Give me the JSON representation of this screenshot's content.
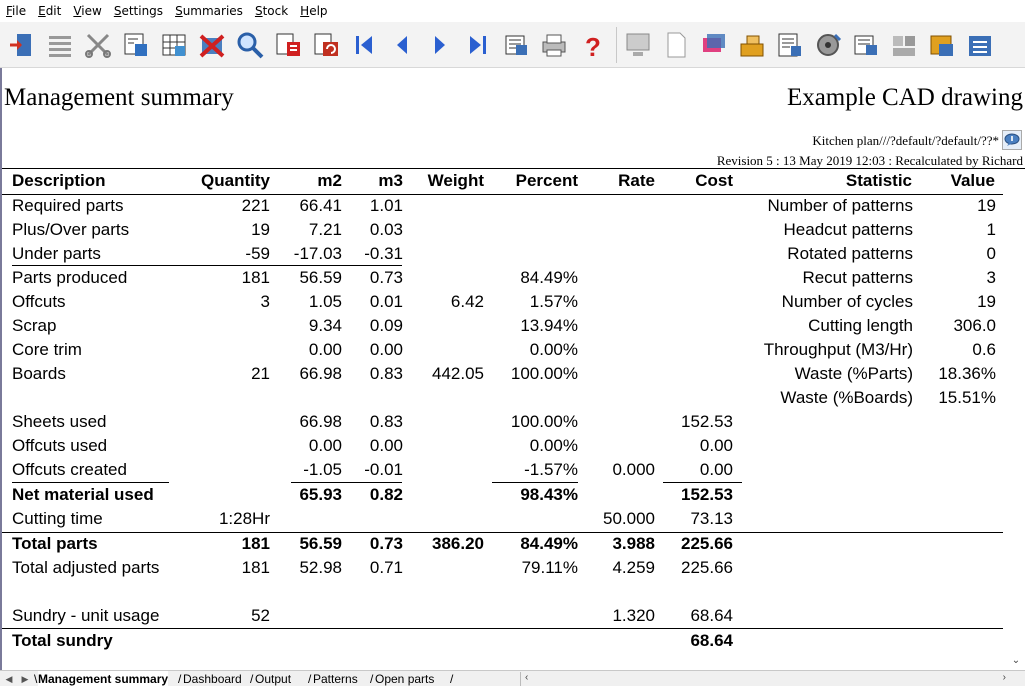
{
  "menu": [
    "File",
    "Edit",
    "View",
    "Settings",
    "Summaries",
    "Stock",
    "Help"
  ],
  "toolbar_icons": [
    "exit-icon",
    "list-icon",
    "scissors-icon",
    "print-preview-icon",
    "grid-icon",
    "cancel-icon",
    "magnifier-icon",
    "report-icon",
    "recalculate-icon",
    "first-page-icon",
    "previous-page-icon",
    "next-page-icon",
    "last-page-icon",
    "export-icon",
    "printer-icon",
    "help-icon",
    "layout-icon",
    "blank-page-icon",
    "labels-icon",
    "stock-icon",
    "edit-icon",
    "saw-icon",
    "batch-icon",
    "pattern-icon",
    "parts-icon",
    "options-icon"
  ],
  "report": {
    "title": "Management summary",
    "drawing": "Example CAD drawing",
    "plan_line": "Kitchen plan///?default/?default/??*",
    "revision_line": "Revision 5 : 13 May 2019 12:03 : Recalculated by Richard"
  },
  "table": {
    "headers": {
      "description": "Description",
      "quantity": "Quantity",
      "m2": "m2",
      "m3": "m3",
      "weight": "Weight",
      "percent": "Percent",
      "rate": "Rate",
      "cost": "Cost"
    },
    "rows": [
      {
        "d": "Required parts",
        "q": "221",
        "m2": "66.41",
        "m3": "1.01",
        "w": "",
        "p": "",
        "r": "",
        "c": "",
        "bold": false
      },
      {
        "d": "Plus/Over parts",
        "q": "19",
        "m2": "7.21",
        "m3": "0.03",
        "w": "",
        "p": "",
        "r": "",
        "c": "",
        "bold": false
      },
      {
        "d": "Under parts",
        "q": "-59",
        "m2": "-17.03",
        "m3": "-0.31",
        "w": "",
        "p": "",
        "r": "",
        "c": "",
        "bold": false
      },
      {
        "d": "Parts produced",
        "q": "181",
        "m2": "56.59",
        "m3": "0.73",
        "w": "",
        "p": "84.49%",
        "r": "",
        "c": "",
        "bold": false
      },
      {
        "d": "Offcuts",
        "q": "3",
        "m2": "1.05",
        "m3": "0.01",
        "w": "6.42",
        "p": "1.57%",
        "r": "",
        "c": "",
        "bold": false
      },
      {
        "d": "Scrap",
        "q": "",
        "m2": "9.34",
        "m3": "0.09",
        "w": "",
        "p": "13.94%",
        "r": "",
        "c": "",
        "bold": false
      },
      {
        "d": "Core trim",
        "q": "",
        "m2": "0.00",
        "m3": "0.00",
        "w": "",
        "p": "0.00%",
        "r": "",
        "c": "",
        "bold": false
      },
      {
        "d": "Boards",
        "q": "21",
        "m2": "66.98",
        "m3": "0.83",
        "w": "442.05",
        "p": "100.00%",
        "r": "",
        "c": "",
        "bold": false
      },
      {
        "d": "Sheets used",
        "q": "",
        "m2": "66.98",
        "m3": "0.83",
        "w": "",
        "p": "100.00%",
        "r": "",
        "c": "152.53",
        "bold": false
      },
      {
        "d": "Offcuts used",
        "q": "",
        "m2": "0.00",
        "m3": "0.00",
        "w": "",
        "p": "0.00%",
        "r": "",
        "c": "0.00",
        "bold": false
      },
      {
        "d": "Offcuts created",
        "q": "",
        "m2": "-1.05",
        "m3": "-0.01",
        "w": "",
        "p": "-1.57%",
        "r": "0.000",
        "c": "0.00",
        "bold": false
      },
      {
        "d": "Net material used",
        "q": "",
        "m2": "65.93",
        "m3": "0.82",
        "w": "",
        "p": "98.43%",
        "r": "",
        "c": "152.53",
        "bold": true
      },
      {
        "d": "Cutting time",
        "q": "1:28Hr",
        "m2": "",
        "m3": "",
        "w": "",
        "p": "",
        "r": "50.000",
        "c": "73.13",
        "bold": false
      },
      {
        "d": "Total parts",
        "q": "181",
        "m2": "56.59",
        "m3": "0.73",
        "w": "386.20",
        "p": "84.49%",
        "r": "3.988",
        "c": "225.66",
        "bold": true
      },
      {
        "d": "Total adjusted parts",
        "q": "181",
        "m2": "52.98",
        "m3": "0.71",
        "w": "",
        "p": "79.11%",
        "r": "4.259",
        "c": "225.66",
        "bold": false
      },
      {
        "d": "Sundry - unit usage",
        "q": "52",
        "m2": "",
        "m3": "",
        "w": "",
        "p": "",
        "r": "1.320",
        "c": "68.64",
        "bold": false
      },
      {
        "d": "Total sundry",
        "q": "",
        "m2": "",
        "m3": "",
        "w": "",
        "p": "",
        "r": "",
        "c": "68.64",
        "bold": true
      }
    ]
  },
  "stats": {
    "headers": {
      "statistic": "Statistic",
      "value": "Value"
    },
    "rows": [
      {
        "label": "Number of patterns",
        "value": "19"
      },
      {
        "label": "Headcut patterns",
        "value": "1"
      },
      {
        "label": "Rotated patterns",
        "value": "0"
      },
      {
        "label": "Recut patterns",
        "value": "3"
      },
      {
        "label": "Number of cycles",
        "value": "19"
      },
      {
        "label": "Cutting length",
        "value": "306.0"
      },
      {
        "label": "Throughput (M3/Hr)",
        "value": "0.6"
      },
      {
        "label": "Waste (%Parts)",
        "value": "18.36%"
      },
      {
        "label": "Waste (%Boards)",
        "value": "15.51%"
      }
    ]
  },
  "tabs": [
    {
      "label": "Management summary",
      "active": true
    },
    {
      "label": "Dashboard",
      "active": false
    },
    {
      "label": "Output",
      "active": false
    },
    {
      "label": "Patterns",
      "active": false
    },
    {
      "label": "Open parts",
      "active": false
    }
  ]
}
